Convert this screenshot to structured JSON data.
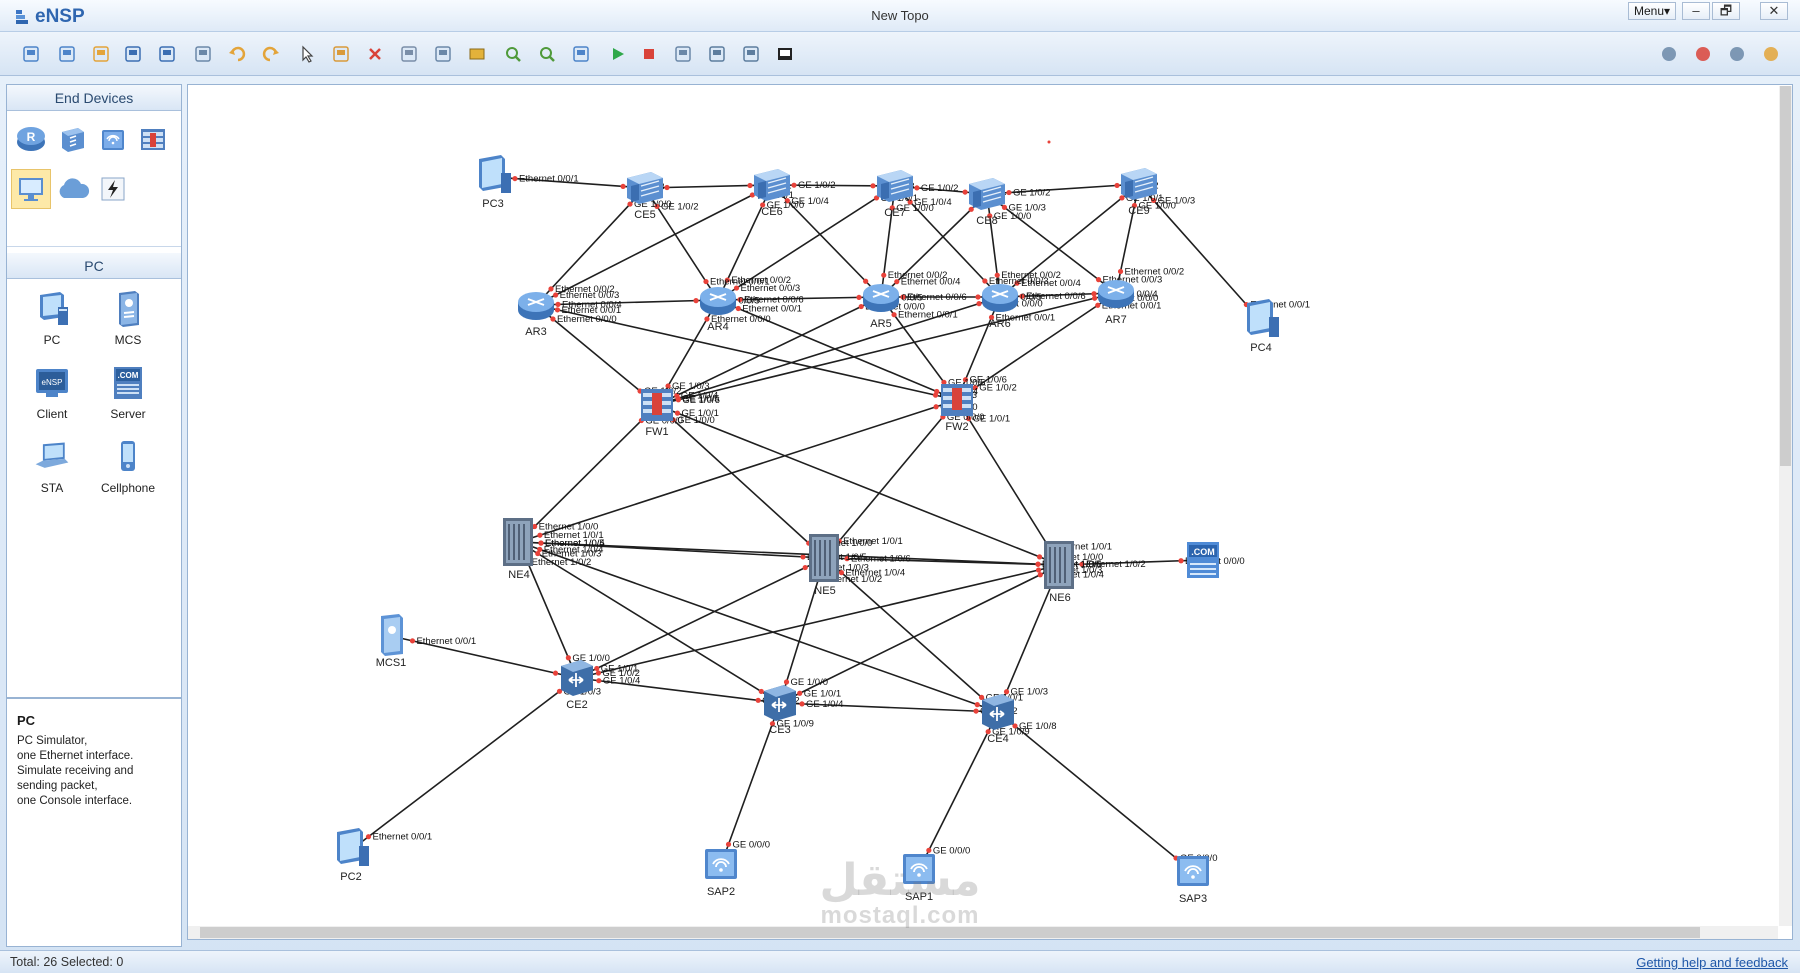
{
  "app": {
    "logo": "eNSP",
    "title": "New Topo",
    "menu_label": "Menu▾",
    "controls": [
      "–",
      "🗗",
      "✕"
    ]
  },
  "toolbar": {
    "icons": [
      "new-topo-icon",
      "new-file-icon",
      "open-icon",
      "save-icon",
      "save-as-icon",
      "print-icon",
      "undo-icon",
      "redo-icon",
      "select-icon",
      "hand-icon",
      "delete-icon",
      "delete-all-icon",
      "text-icon",
      "rectangle-icon",
      "zoom-in-icon",
      "zoom-out-icon",
      "fit-icon",
      "start-icon",
      "stop-icon",
      "capture-icon",
      "topology-icon",
      "grid-icon",
      "console-icon"
    ],
    "right_icons": [
      "chat-icon",
      "huawei-icon",
      "settings-icon",
      "help-icon"
    ]
  },
  "left_panel": {
    "end_devices_title": "End Devices",
    "pc_title": "PC",
    "pc_items": [
      {
        "label": "PC"
      },
      {
        "label": "MCS"
      },
      {
        "label": "Client"
      },
      {
        "label": "Server"
      },
      {
        "label": "STA"
      },
      {
        "label": "Cellphone"
      }
    ],
    "description": {
      "title": "PC",
      "lines": [
        "PC Simulator,",
        "one Ethernet interface.",
        "Simulate receiving and",
        "sending packet,",
        "one Console interface."
      ]
    }
  },
  "topology": {
    "nodes": [
      {
        "id": "PC3",
        "label": "PC3",
        "type": "pc"
      },
      {
        "id": "CE5",
        "label": "CE5",
        "type": "switch"
      },
      {
        "id": "CE6",
        "label": "CE6",
        "type": "switch"
      },
      {
        "id": "CE7",
        "label": "CE7",
        "type": "switch"
      },
      {
        "id": "CE8",
        "label": "CE8",
        "type": "switch"
      },
      {
        "id": "CE9",
        "label": "CE9",
        "type": "switch"
      },
      {
        "id": "PC4",
        "label": "PC4",
        "type": "pc"
      },
      {
        "id": "AR3",
        "label": "AR3",
        "type": "router"
      },
      {
        "id": "AR4",
        "label": "AR4",
        "type": "router"
      },
      {
        "id": "AR5",
        "label": "AR5",
        "type": "router"
      },
      {
        "id": "AR6",
        "label": "AR6",
        "type": "router"
      },
      {
        "id": "AR7",
        "label": "AR7",
        "type": "router"
      },
      {
        "id": "FW1",
        "label": "FW1",
        "type": "firewall"
      },
      {
        "id": "FW2",
        "label": "FW2",
        "type": "firewall"
      },
      {
        "id": "NE4",
        "label": "NE4",
        "type": "ne"
      },
      {
        "id": "NE5",
        "label": "NE5",
        "type": "ne"
      },
      {
        "id": "NE6",
        "label": "NE6",
        "type": "ne"
      },
      {
        "id": "Server",
        "label": "",
        "type": "server"
      },
      {
        "id": "MCS1",
        "label": "MCS1",
        "type": "mcs"
      },
      {
        "id": "CE2",
        "label": "CE2",
        "type": "ce"
      },
      {
        "id": "CE3",
        "label": "CE3",
        "type": "ce"
      },
      {
        "id": "CE4",
        "label": "CE4",
        "type": "ce"
      },
      {
        "id": "PC2",
        "label": "PC2",
        "type": "pc"
      },
      {
        "id": "SAP2",
        "label": "SAP2",
        "type": "ap"
      },
      {
        "id": "SAP1",
        "label": "SAP1",
        "type": "ap"
      },
      {
        "id": "SAP3",
        "label": "SAP3",
        "type": "ap"
      }
    ],
    "links": [
      [
        "PC3",
        "CE5",
        "Ethernet 0/0/1",
        "GE 1/0/3"
      ],
      [
        "CE5",
        "CE6",
        "",
        "GE 1/0/1"
      ],
      [
        "CE6",
        "CE7",
        "GE 1/0/2",
        "GE 1/0/3"
      ],
      [
        "CE7",
        "CE8",
        "GE 1/0/2",
        "GE 1/0/1"
      ],
      [
        "CE8",
        "CE9",
        "GE 1/0/2",
        "GE 1/0/2"
      ],
      [
        "CE9",
        "PC4",
        "GE 1/0/3",
        "Ethernet 0/0/1"
      ],
      [
        "CE5",
        "AR3",
        "GE 1/0/0",
        "Ethernet 0/0/2"
      ],
      [
        "CE5",
        "AR4",
        "GE 1/0/2",
        "Ethernet 0/0/1"
      ],
      [
        "CE6",
        "AR3",
        "GE 1/0/1",
        "Ethernet 0/0/3"
      ],
      [
        "CE6",
        "AR4",
        "GE 1/0/0",
        "Ethernet 0/0/2"
      ],
      [
        "CE6",
        "AR5",
        "GE 1/0/4",
        ""
      ],
      [
        "CE7",
        "AR4",
        "GE 1/0/1",
        "Ethernet 0/0/3"
      ],
      [
        "CE7",
        "AR5",
        "GE 1/0/0",
        "Ethernet 0/0/2"
      ],
      [
        "CE7",
        "AR6",
        "GE 1/0/4",
        "Ethernet 0/0/3"
      ],
      [
        "CE8",
        "AR5",
        "",
        "Ethernet 0/0/4"
      ],
      [
        "CE8",
        "AR6",
        "GE 1/0/0",
        "Ethernet 0/0/2"
      ],
      [
        "CE8",
        "AR7",
        "GE 1/0/3",
        "Ethernet 0/0/3"
      ],
      [
        "CE9",
        "AR6",
        "GE 1/0/1",
        "Ethernet 0/0/4"
      ],
      [
        "CE9",
        "AR7",
        "GE 1/0/0",
        "Ethernet 0/0/2"
      ],
      [
        "AR3",
        "AR4",
        "Ethernet 0/0/4",
        "Ethernet 0/0/5"
      ],
      [
        "AR4",
        "AR5",
        "Ethernet 0/0/6",
        "Ethernet 0/0/5"
      ],
      [
        "AR5",
        "AR6",
        "Ethernet 0/0/6",
        "Ethernet 0/0/5"
      ],
      [
        "AR6",
        "AR7",
        "Ethernet 0/0/6",
        "Ethernet 0/0/4"
      ],
      [
        "AR3",
        "FW1",
        "Ethernet 0/0/0",
        "GE 1/0/2"
      ],
      [
        "AR3",
        "FW2",
        "Ethernet 0/0/1",
        "GE 1/0/3"
      ],
      [
        "AR4",
        "FW1",
        "Ethernet 0/0/0",
        "GE 1/0/3"
      ],
      [
        "AR4",
        "FW2",
        "Ethernet 0/0/1",
        "GE 1/0/4"
      ],
      [
        "AR5",
        "FW1",
        "Ethernet 0/0/0",
        "GE 1/0/4"
      ],
      [
        "AR5",
        "FW2",
        "Ethernet 0/0/1",
        "GE 1/0/5"
      ],
      [
        "AR6",
        "FW1",
        "Ethernet 0/0/0",
        "GE 1/0/5"
      ],
      [
        "AR6",
        "FW2",
        "Ethernet 0/0/1",
        "GE 1/0/6"
      ],
      [
        "AR7",
        "FW1",
        "Ethernet 0/0/0",
        "GE 1/0/6"
      ],
      [
        "AR7",
        "FW2",
        "Ethernet 0/0/1",
        "GE 1/0/2"
      ],
      [
        "FW1",
        "NE4",
        "GE 0/0/0",
        "Ethernet 1/0/0"
      ],
      [
        "FW1",
        "NE6",
        "GE 1/0/1",
        "Ethernet 1/0/0"
      ],
      [
        "FW2",
        "NE4",
        "GE 0/0/0",
        "Ethernet 1/0/1"
      ],
      [
        "FW2",
        "NE6",
        "GE 1/0/1",
        "Ethernet 1/0/1"
      ],
      [
        "FW1",
        "NE5",
        "GE 1/0/0",
        "Ethernet 1/0/0"
      ],
      [
        "FW2",
        "NE5",
        "GE 0/0/0",
        "Ethernet 1/0/1"
      ],
      [
        "NE4",
        "NE5",
        "Ethernet 1/0/5",
        "Ethernet 1/0/5"
      ],
      [
        "NE4",
        "NE6",
        "Ethernet 1/0/4",
        "Ethernet 1/0/5"
      ],
      [
        "NE5",
        "NE6",
        "Ethernet 1/0/6",
        "Ethernet 1/0/6"
      ],
      [
        "NE6",
        "Server",
        "Ethernet 1/0/2",
        "Ethernet 0/0/0"
      ],
      [
        "NE4",
        "CE2",
        "Ethernet 1/0/2",
        "GE 1/0/0"
      ],
      [
        "NE4",
        "CE3",
        "Ethernet 1/0/3",
        ""
      ],
      [
        "NE4",
        "CE4",
        "Ethernet 1/0/4",
        ""
      ],
      [
        "NE5",
        "CE2",
        "Ethernet 1/0/3",
        "GE 1/0/1"
      ],
      [
        "NE5",
        "CE3",
        "Ethernet 1/0/2",
        "GE 1/0/0"
      ],
      [
        "NE5",
        "CE4",
        "Ethernet 1/0/4",
        "GE 1/0/1"
      ],
      [
        "NE6",
        "CE2",
        "Ethernet 1/0/3",
        "GE 1/0/2"
      ],
      [
        "NE6",
        "CE3",
        "Ethernet 1/0/4",
        "GE 1/0/1"
      ],
      [
        "NE6",
        "CE4",
        "",
        "GE 1/0/3"
      ],
      [
        "MCS1",
        "CE2",
        "Ethernet 0/0/1",
        ""
      ],
      [
        "CE2",
        "CE3",
        "GE 1/0/4",
        "GE 1/0/2"
      ],
      [
        "CE3",
        "CE4",
        "GE 1/0/4",
        "GE 1/0/2"
      ],
      [
        "CE2",
        "PC2",
        "GE 1/0/3",
        "Ethernet 0/0/1"
      ],
      [
        "CE3",
        "SAP2",
        "GE 1/0/9",
        "GE 0/0/0"
      ],
      [
        "CE4",
        "SAP1",
        "GE 1/0/9",
        "GE 0/0/0"
      ],
      [
        "CE4",
        "SAP3",
        "GE 1/0/8",
        "GE 0/0/0"
      ]
    ]
  },
  "status": {
    "total": "Total: 26  Selected: 0",
    "help": "Getting help and feedback"
  },
  "watermark": {
    "arabic": "مستقل",
    "latin": "mostaql.com"
  },
  "colors": {
    "link_dot": "#e8423a",
    "link_line": "#1f1f1f",
    "accent": "#2f66b0"
  }
}
